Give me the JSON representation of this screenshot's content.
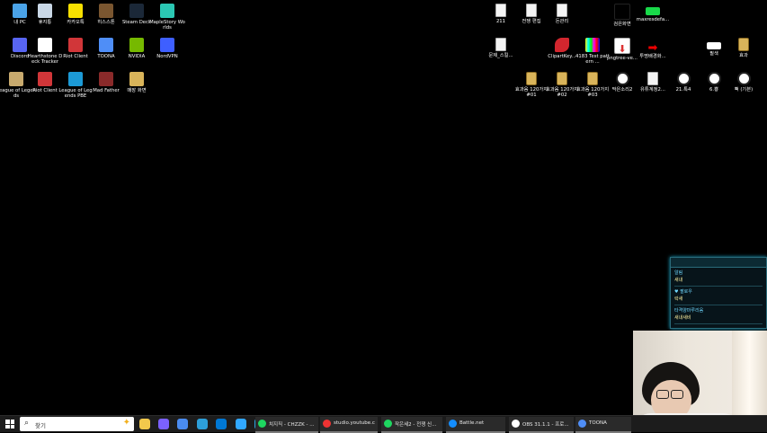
{
  "desktop_left": [
    {
      "label": "내 PC",
      "color": "#4aa3e8"
    },
    {
      "label": "휴지통",
      "color": "#c9d7e6"
    },
    {
      "label": "카카오톡",
      "color": "#f7e000"
    },
    {
      "label": "히스스톤",
      "color": "#7a5630"
    },
    {
      "label": "Steam Deck",
      "color": "#1b2838"
    },
    {
      "label": "MapleStory Worlds",
      "color": "#2bc7b3"
    },
    {
      "label": "Discord",
      "color": "#5865f2"
    },
    {
      "label": "Hearthstone Deck Tracker",
      "color": "#ffffff"
    },
    {
      "label": "Riot Client",
      "color": "#d13639"
    },
    {
      "label": "TOONA",
      "color": "#4f8ef7"
    },
    {
      "label": "NVIDIA",
      "color": "#76b900"
    },
    {
      "label": "NordVPN",
      "color": "#3e5fff"
    },
    {
      "label": "League of Legends",
      "color": "#c8aa6e"
    },
    {
      "label": "Riot Client",
      "color": "#d13639"
    },
    {
      "label": "League of Legends PBE",
      "color": "#1c9ad6"
    },
    {
      "label": "Mad Father",
      "color": "#8a2a2a"
    },
    {
      "label": "매장 화면",
      "color": "#d9b45a"
    }
  ],
  "desktop_right": [
    {
      "label": "211",
      "kind": "doc"
    },
    {
      "label": "전쟁 편집",
      "kind": "doc"
    },
    {
      "label": "돈관리",
      "kind": "doc"
    },
    {
      "label": "검은화면",
      "kind": "black"
    },
    {
      "label": "maxresdefa...",
      "kind": "green"
    },
    {
      "label": "문제_스킬...",
      "kind": "doc"
    },
    {
      "label": "ClipartKey...",
      "kind": "red"
    },
    {
      "label": "4183 Test pattern ...",
      "kind": "test"
    },
    {
      "label": "pngtree-ve...",
      "kind": "down"
    },
    {
      "label": "투명배경화...",
      "kind": "arrow"
    },
    {
      "label": "필색",
      "kind": "white"
    },
    {
      "label": "효과",
      "kind": "zip"
    },
    {
      "label": "효과음 120가지 #01",
      "kind": "zip"
    },
    {
      "label": "효과음 120가지 #02",
      "kind": "zip"
    },
    {
      "label": "효과음 120가지 #03",
      "kind": "zip"
    },
    {
      "label": "막은소리2",
      "kind": "obs"
    },
    {
      "label": "유튜계정2...",
      "kind": "doc"
    },
    {
      "label": "21.톡4",
      "kind": "obs"
    },
    {
      "label": "6.뿅",
      "kind": "obs"
    },
    {
      "label": "뻑 (기본)",
      "kind": "obs"
    }
  ],
  "widget": {
    "rows": [
      {
        "title": "알림",
        "value": "새내"
      },
      {
        "title": "♥ 팔로우",
        "value": "락새"
      },
      {
        "title": "타격양마루리움",
        "value": "새내새비"
      }
    ]
  },
  "taskbar": {
    "search_placeholder": "찾기",
    "pins": [
      "#f2c94c",
      "#7b61ff",
      "#4a8cf0",
      "#2d9fd9",
      "#0078d4",
      "#31a8ff",
      "#2aa5e0"
    ],
    "tasks": [
      {
        "label": "치지직 - CHZZK - ...",
        "color": "#1ed760"
      },
      {
        "label": "studio.youtube.co...",
        "color": "#e33"
      },
      {
        "label": "작은세2 - 전쟁 신...",
        "color": "#1ed760"
      },
      {
        "label": "Battle.net",
        "color": "#148eff"
      },
      {
        "label": "OBS 31.1.1 - 프로...",
        "color": "#ffffff"
      },
      {
        "label": "TOONA",
        "color": "#4f8ef7"
      }
    ]
  }
}
